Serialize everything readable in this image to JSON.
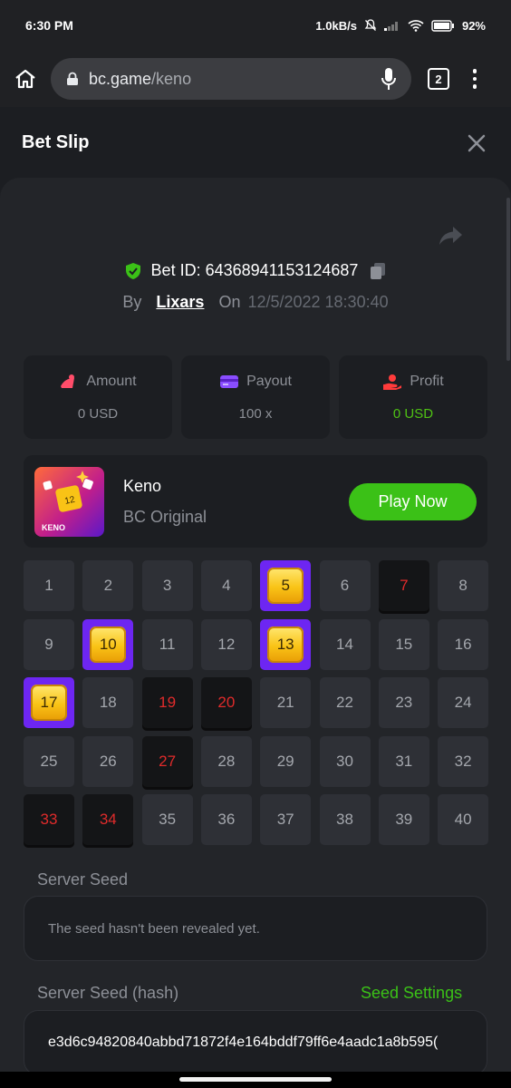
{
  "status_bar": {
    "time": "6:30 PM",
    "net_speed": "1.0kB/s",
    "battery": "92%"
  },
  "browser": {
    "url_domain": "bc.game",
    "url_path": "/keno",
    "tab_count": "2"
  },
  "header": {
    "title": "Bet Slip"
  },
  "bet": {
    "id_label": "Bet ID:",
    "id_value": "64368941153124687",
    "by_label": "By",
    "user": "Lixars",
    "on_label": "On",
    "date": "12/5/2022 18:30:40"
  },
  "stats": [
    {
      "label": "Amount",
      "value": "0 USD",
      "icon": "amount-icon",
      "icon_color": "#ff4d6a"
    },
    {
      "label": "Payout",
      "value": "100 x",
      "icon": "wallet-icon",
      "icon_color": "#8a4dff"
    },
    {
      "label": "Profit",
      "value": "0 USD",
      "icon": "profit-icon",
      "icon_color": "#ff3b3b",
      "value_color": "#4fc214"
    }
  ],
  "game": {
    "name": "Keno",
    "subtitle": "BC Original",
    "thumb_text": "KENO",
    "thumb_tile": "12",
    "play_label": "Play Now"
  },
  "keno": {
    "numbers": [
      "1",
      "2",
      "3",
      "4",
      "5",
      "6",
      "7",
      "8",
      "9",
      "10",
      "11",
      "12",
      "13",
      "14",
      "15",
      "16",
      "17",
      "18",
      "19",
      "20",
      "21",
      "22",
      "23",
      "24",
      "25",
      "26",
      "27",
      "28",
      "29",
      "30",
      "31",
      "32",
      "33",
      "34",
      "35",
      "36",
      "37",
      "38",
      "39",
      "40"
    ],
    "hits": [
      5,
      10,
      13,
      17
    ],
    "misses": [
      7,
      19,
      20,
      27,
      33,
      34
    ]
  },
  "server_seed": {
    "label": "Server Seed",
    "value": "The seed hasn't been revealed yet."
  },
  "server_seed_hash": {
    "label": "Server Seed (hash)",
    "settings_label": "Seed Settings",
    "value": "e3d6c94820840abbd71872f4e164bddf79ff6e4aadc1a8b595("
  },
  "colors": {
    "accent_green": "#3bc117",
    "hit_purple": "#6d26f2",
    "miss_red": "#e02b2b"
  }
}
